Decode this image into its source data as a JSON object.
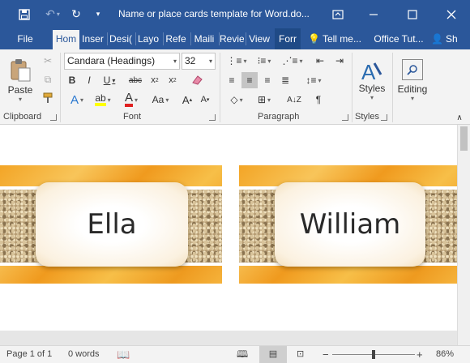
{
  "titlebar": {
    "title": "Name or place cards template for Word.do...",
    "save_icon": "save-icon",
    "undo_icon": "undo-icon",
    "redo_icon": "redo-icon",
    "restore_icon": "ribbon-display-options-icon",
    "minimize_icon": "minimize-icon",
    "maximize_icon": "maximize-icon",
    "close_icon": "close-icon"
  },
  "tabs": [
    {
      "label": "File"
    },
    {
      "label": "Hom"
    },
    {
      "label": "Inser"
    },
    {
      "label": "Desi("
    },
    {
      "label": "Layo"
    },
    {
      "label": "Refe"
    },
    {
      "label": "Maili"
    },
    {
      "label": "Revie"
    },
    {
      "label": "View"
    },
    {
      "label": "Forr"
    },
    {
      "label": "Tell me..."
    },
    {
      "label": "Office Tut..."
    },
    {
      "label": "Sh"
    }
  ],
  "ribbon": {
    "clipboard": {
      "label": "Clipboard",
      "paste": "Paste"
    },
    "font": {
      "label": "Font",
      "font_name": "Candara (Headings)",
      "font_size": "32"
    },
    "paragraph": {
      "label": "Paragraph"
    },
    "styles": {
      "label": "Styles",
      "button": "Styles"
    },
    "editing": {
      "button": "Editing"
    }
  },
  "cards": [
    {
      "name": "Ella"
    },
    {
      "name": "William"
    }
  ],
  "statusbar": {
    "page": "Page 1 of 1",
    "words": "0 words",
    "zoom": "86%"
  },
  "colors": {
    "accent": "#2b579a",
    "ribbon_bg": "#f3f3f3",
    "card_orange": "#f3a526"
  }
}
